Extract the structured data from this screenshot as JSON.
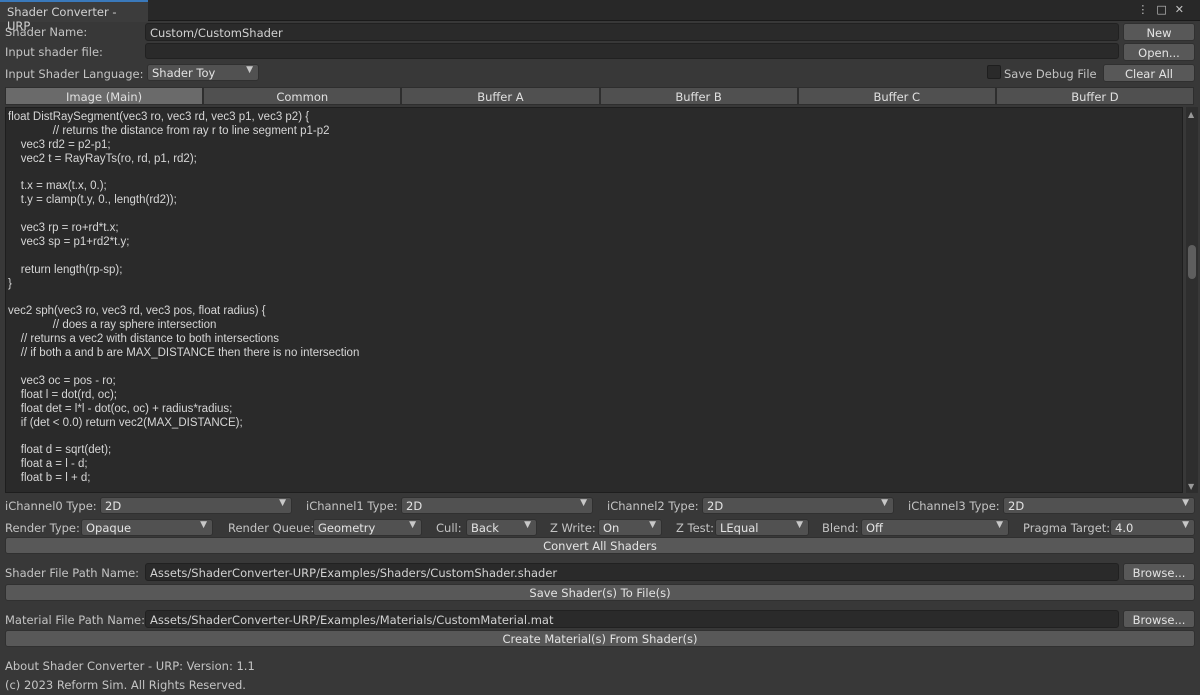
{
  "window": {
    "tab_title": "Shader Converter - URP",
    "icons": [
      "menu-icon",
      "maximize-icon",
      "close-icon"
    ]
  },
  "header": {
    "shader_name_label": "Shader Name:",
    "shader_name_value": "Custom/CustomShader",
    "new_button": "New",
    "input_file_label": "Input shader file:",
    "input_file_value": "",
    "open_button": "Open...",
    "language_label": "Input Shader Language:",
    "language_value": "Shader Toy",
    "save_debug_label": "Save Debug File",
    "clear_all_button": "Clear All"
  },
  "tabs": [
    {
      "label": "Image (Main)",
      "active": true
    },
    {
      "label": "Common",
      "active": false
    },
    {
      "label": "Buffer A",
      "active": false
    },
    {
      "label": "Buffer B",
      "active": false
    },
    {
      "label": "Buffer C",
      "active": false
    },
    {
      "label": "Buffer D",
      "active": false
    }
  ],
  "code_lines": [
    "float DistRaySegment(vec3 ro, vec3 rd, vec3 p1, vec3 p2) {",
    "              // returns the distance from ray r to line segment p1-p2",
    "    vec3 rd2 = p2-p1;",
    "    vec2 t = RayRayTs(ro, rd, p1, rd2);",
    "",
    "    t.x = max(t.x, 0.);",
    "    t.y = clamp(t.y, 0., length(rd2));",
    "",
    "    vec3 rp = ro+rd*t.x;",
    "    vec3 sp = p1+rd2*t.y;",
    "",
    "    return length(rp-sp);",
    "}",
    "",
    "vec2 sph(vec3 ro, vec3 rd, vec3 pos, float radius) {",
    "              // does a ray sphere intersection",
    "    // returns a vec2 with distance to both intersections",
    "    // if both a and b are MAX_DISTANCE then there is no intersection",
    "",
    "    vec3 oc = pos - ro;",
    "    float l = dot(rd, oc);",
    "    float det = l*l - dot(oc, oc) + radius*radius;",
    "    if (det < 0.0) return vec2(MAX_DISTANCE);",
    "",
    "    float d = sqrt(det);",
    "    float a = l - d;",
    "    float b = l + d;"
  ],
  "channels": [
    {
      "label": "iChannel0 Type:",
      "value": "2D"
    },
    {
      "label": "iChannel1 Type:",
      "value": "2D"
    },
    {
      "label": "iChannel2 Type:",
      "value": "2D"
    },
    {
      "label": "iChannel3 Type:",
      "value": "2D"
    }
  ],
  "render": {
    "render_type_label": "Render Type:",
    "render_type_value": "Opaque",
    "render_queue_label": "Render Queue:",
    "render_queue_value": "Geometry",
    "cull_label": "Cull:",
    "cull_value": "Back",
    "zwrite_label": "Z Write:",
    "zwrite_value": "On",
    "ztest_label": "Z Test:",
    "ztest_value": "LEqual",
    "blend_label": "Blend:",
    "blend_value": "Off",
    "pragma_label": "Pragma Target:",
    "pragma_value": "4.0"
  },
  "actions": {
    "convert_all": "Convert All Shaders",
    "shader_path_label": "Shader File Path Name:",
    "shader_path_value": "Assets/ShaderConverter-URP/Examples/Shaders/CustomShader.shader",
    "browse": "Browse...",
    "save_shaders": "Save Shader(s) To File(s)",
    "material_path_label": "Material File Path Name:",
    "material_path_value": "Assets/ShaderConverter-URP/Examples/Materials/CustomMaterial.mat",
    "create_materials": "Create Material(s) From Shader(s)"
  },
  "footer": {
    "about": "About Shader Converter - URP: Version: 1.1",
    "copyright": "(c) 2023 Reform Sim. All Rights Reserved."
  }
}
